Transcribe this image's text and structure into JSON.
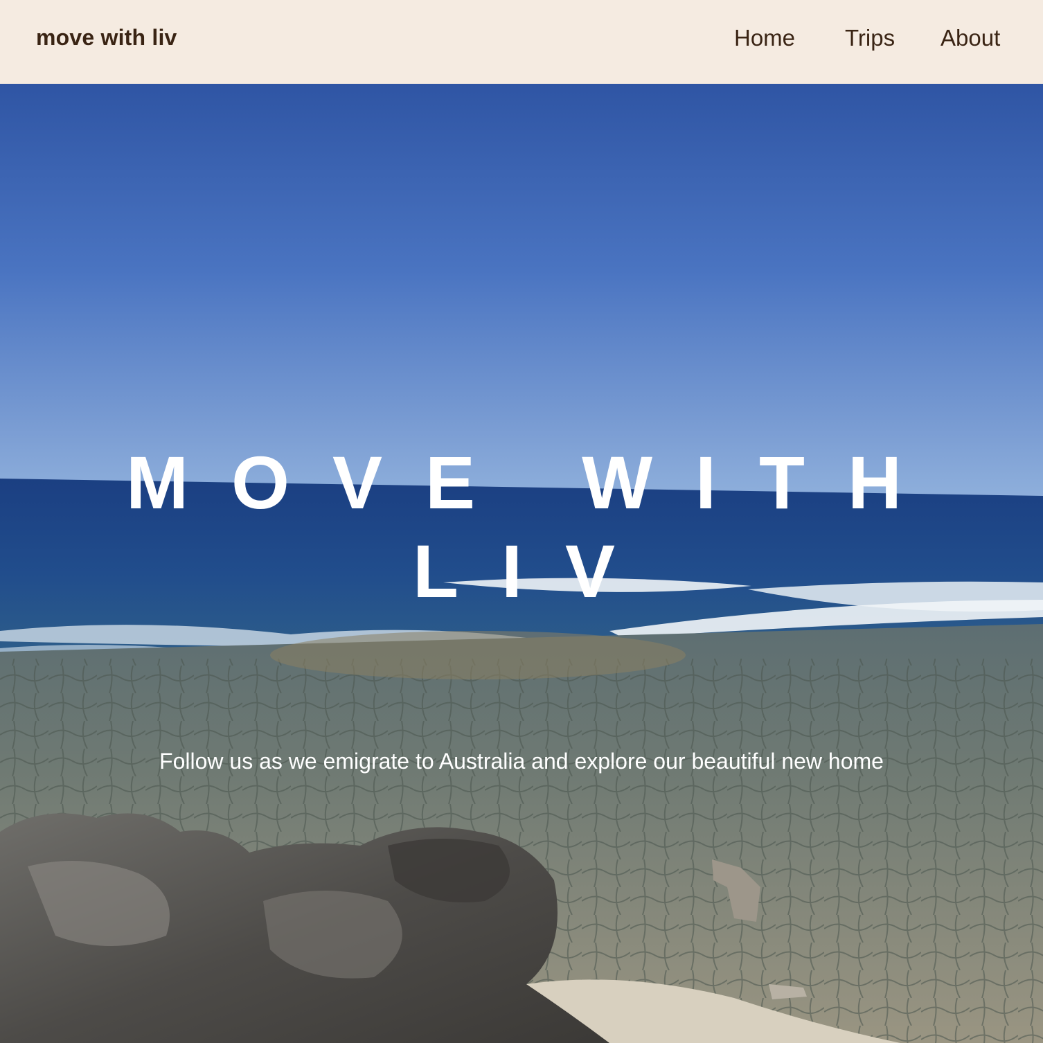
{
  "nav": {
    "brand": "move with liv",
    "links": [
      {
        "label": "Home"
      },
      {
        "label": "Trips"
      },
      {
        "label": "About"
      }
    ]
  },
  "hero": {
    "title": "MOVE WITH\nLIV",
    "tagline": "Follow us as we emigrate to Australia and explore our beautiful new home",
    "background": "coastal-photo"
  },
  "colors": {
    "nav_background": "#f5ebe1",
    "nav_text": "#3a2414",
    "hero_text": "#ffffff"
  }
}
